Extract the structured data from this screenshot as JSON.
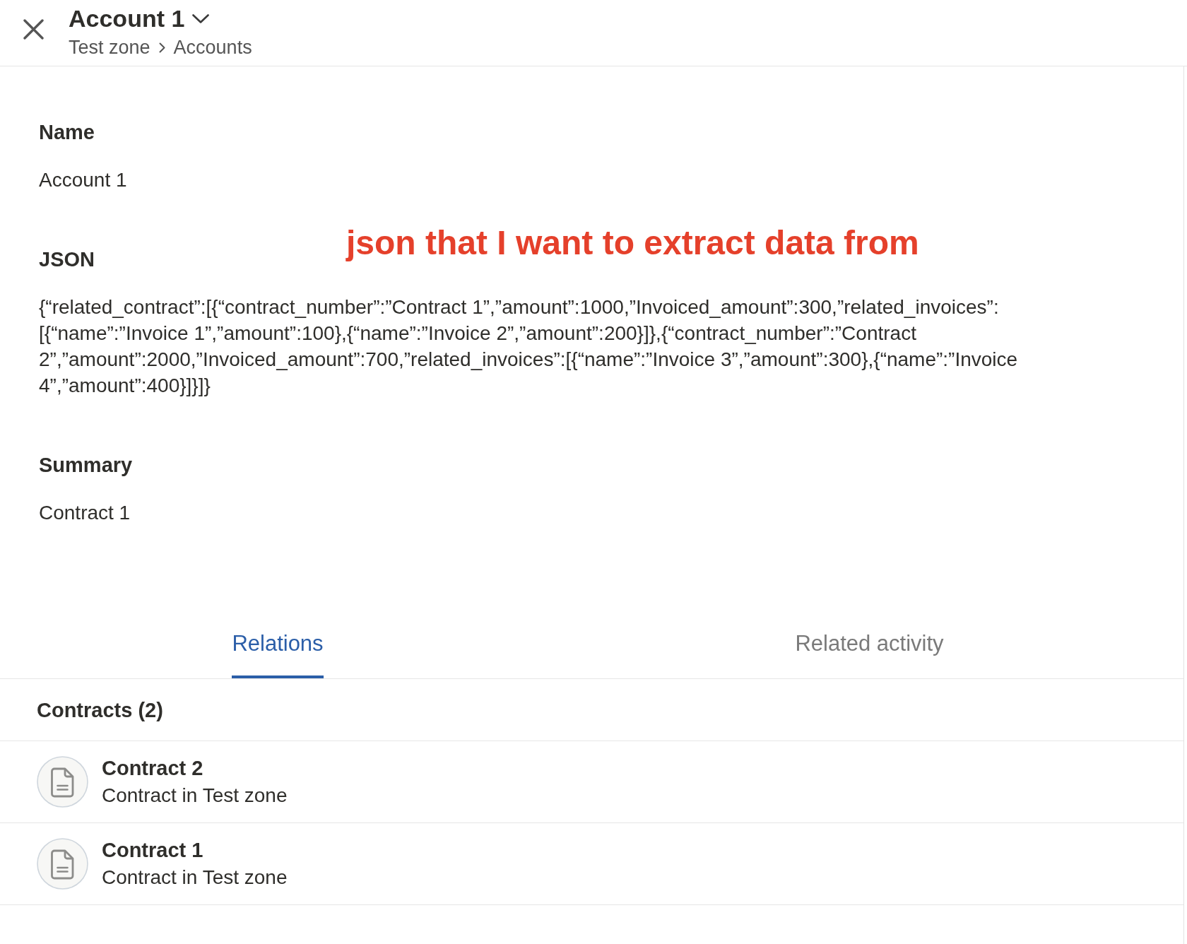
{
  "header": {
    "title": "Account 1",
    "breadcrumb": [
      "Test zone",
      "Accounts"
    ]
  },
  "fields": [
    {
      "label": "Name",
      "value": "Account 1"
    },
    {
      "label": "JSON",
      "value": "{“related_contract”:[{“contract_number”:”Contract 1”,”amount”:1000,”Invoiced_amount”:300,”related_invoices”:[{“name”:”Invoice 1”,”amount”:100},{“name”:”Invoice 2”,”amount”:200}]},{“contract_number”:”Contract 2”,”amount”:2000,”Invoiced_amount”:700,”related_invoices”:[{“name”:”Invoice 3”,”amount”:300},{“name”:”Invoice 4”,”amount”:400}]}]}",
      "annotation": "json that I want to extract data from"
    },
    {
      "label": "Summary",
      "value": "Contract 1"
    }
  ],
  "tabs": [
    {
      "label": "Relations",
      "selected": true
    },
    {
      "label": "Related activity",
      "selected": false
    }
  ],
  "relations": {
    "heading": "Contracts (2)",
    "items": [
      {
        "title": "Contract 2",
        "subtitle": "Contract in Test zone"
      },
      {
        "title": "Contract 1",
        "subtitle": "Contract in Test zone"
      }
    ]
  }
}
